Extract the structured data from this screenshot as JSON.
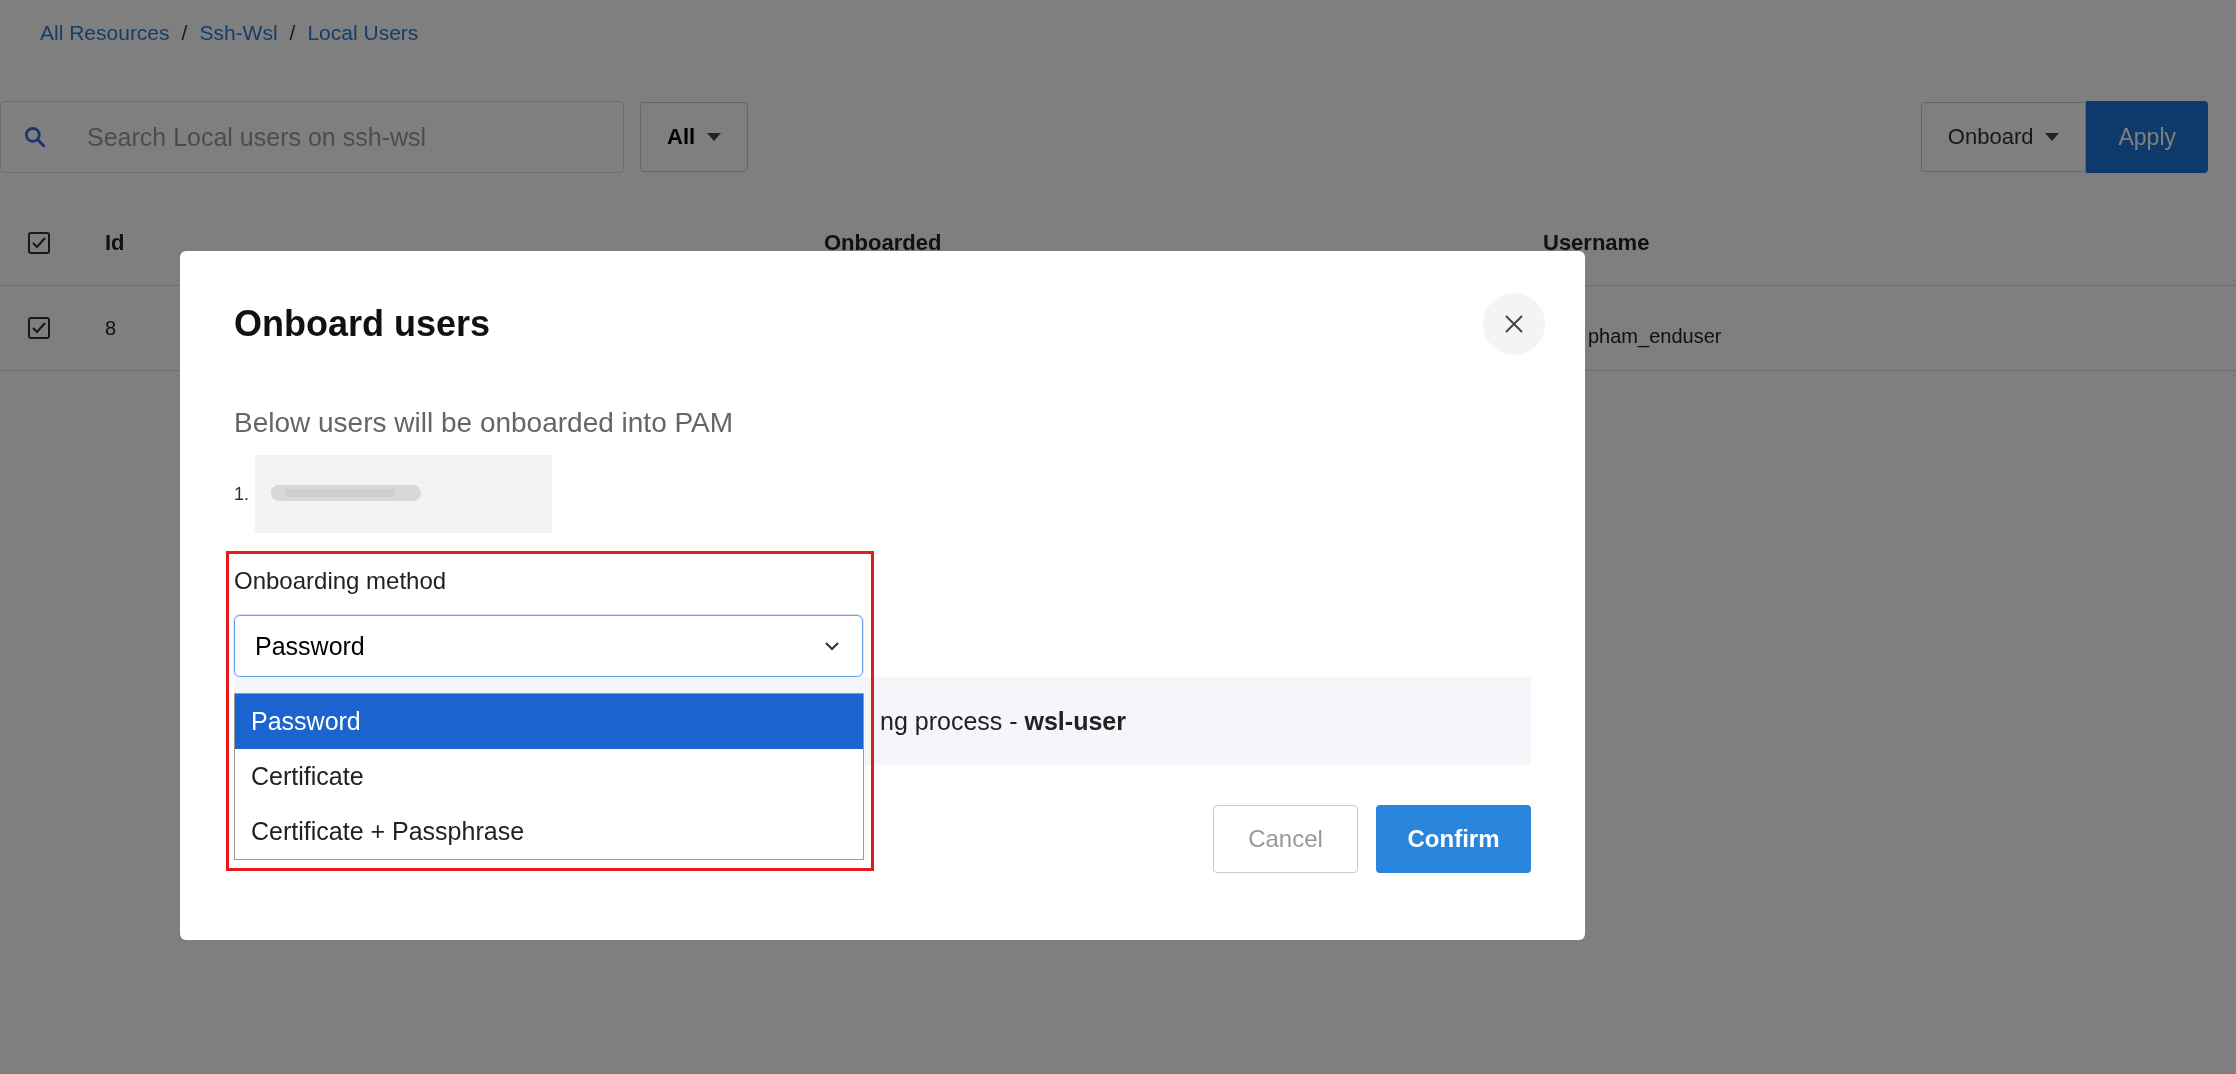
{
  "breadcrumb": [
    {
      "kind": "link",
      "label": "All Resources"
    },
    {
      "kind": "separator",
      "label": "/"
    },
    {
      "kind": "link",
      "label": "Ssh-Wsl"
    },
    {
      "kind": "separator",
      "label": "/"
    },
    {
      "kind": "link",
      "label": "Local Users"
    }
  ],
  "search": {
    "placeholder": "Search Local users on ssh-wsl"
  },
  "filter": {
    "value": "All"
  },
  "action": {
    "value": "Onboard",
    "button": "Apply"
  },
  "table": {
    "header_checked": true,
    "columns": [
      {
        "label": "Id"
      },
      {
        "label": "Onboarded"
      },
      {
        "label": "Username"
      }
    ],
    "rows": [
      {
        "checked": true,
        "id": "8",
        "username": "pham_enduser"
      }
    ]
  },
  "modal": {
    "title": "Onboard users",
    "intro": "Below users will be onboarded into PAM",
    "users": [
      {
        "marker": "1."
      }
    ],
    "method_label": "Onboarding method",
    "select": {
      "value": "Password",
      "expanded": true,
      "options": [
        {
          "label": "Password",
          "selected": true
        },
        {
          "label": "Certificate",
          "selected": false
        },
        {
          "label": "Certificate + Passphrase",
          "selected": false
        }
      ]
    },
    "info": "ng process - **wsl-user**",
    "highlighted": true,
    "buttons": {
      "cancel": "Cancel",
      "confirm": "Confirm"
    }
  }
}
